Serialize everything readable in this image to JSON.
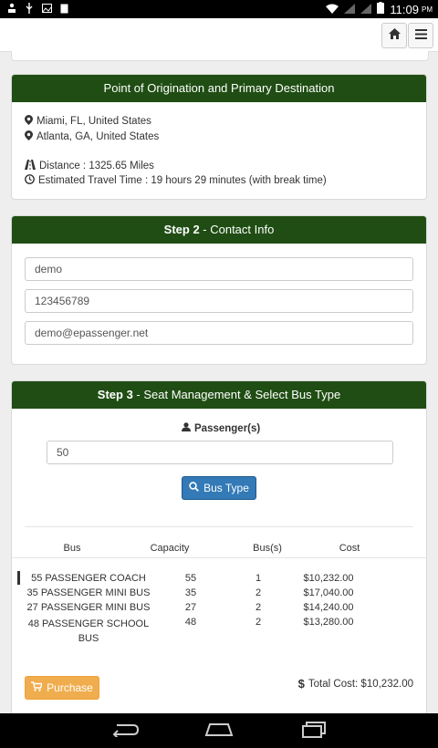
{
  "status_bar": {
    "time": "11:09",
    "ampm": "PM"
  },
  "route": {
    "header": "Point of Origination and Primary Destination",
    "origin": "Miami, FL, United States",
    "destination": "Atlanta, GA, United States",
    "distance": "Distance : 1325.65 Miles",
    "travel_time": "Estimated Travel Time : 19 hours 29 minutes (with break time)"
  },
  "contact": {
    "step_label": "Step 2",
    "title": " - Contact Info",
    "name": "demo",
    "phone": "123456789",
    "email": "demo@epassenger.net"
  },
  "seats": {
    "step_label": "Step 3",
    "title": " - Seat Management & Select Bus Type",
    "passenger_label": "Passenger(s)",
    "passenger_value": "50",
    "bus_type_button": "Bus Type",
    "columns": [
      "Bus",
      "Capacity",
      "Bus(s)",
      "Cost"
    ],
    "rows": [
      {
        "bus": "55 PASSENGER COACH",
        "capacity": "55",
        "count": "1",
        "cost": "$10,232.00",
        "selected": true
      },
      {
        "bus": "35 PASSENGER MINI BUS",
        "capacity": "35",
        "count": "2",
        "cost": "$17,040.00"
      },
      {
        "bus": "27 PASSENGER MINI BUS",
        "capacity": "27",
        "count": "2",
        "cost": "$14,240.00"
      },
      {
        "bus": "48 PASSENGER SCHOOL BUS",
        "capacity": "48",
        "count": "2",
        "cost": "$13,280.00"
      }
    ],
    "purchase_button": "Purchase",
    "total_label": "Total Cost: $10,232.00"
  },
  "colors": {
    "panel_header": "#1f4d13",
    "primary_button": "#337ab7",
    "purchase_button": "#f0ad4e"
  },
  "icons": [
    "map-marker-icon",
    "road-icon",
    "clock-icon",
    "user-icon",
    "search-icon",
    "cart-icon",
    "dollar-icon",
    "home-icon",
    "menu-icon",
    "back-icon",
    "home-nav-icon",
    "recent-apps-icon"
  ]
}
